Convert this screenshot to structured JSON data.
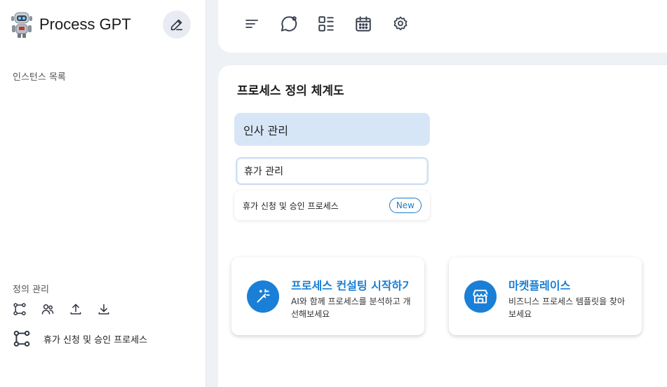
{
  "app": {
    "title": "Process GPT"
  },
  "sidebar": {
    "instances_label": "인스턴스 목록",
    "definitions_label": "정의 관리",
    "definition_icons": [
      "process-flow-icon",
      "users-icon",
      "upload-icon",
      "download-icon"
    ],
    "process_item": "휴가 신청 및 승인 프로세스"
  },
  "toolbar": {
    "icons": [
      "todo-list-icon",
      "chat-bubble-icon",
      "dashboard-list-icon",
      "calendar-icon",
      "gear-icon"
    ]
  },
  "main": {
    "title": "프로세스 정의 체계도",
    "department": "인사 관리",
    "sub_department": "휴가 관리",
    "process": {
      "label": "휴가 신청 및 승인 프로세스",
      "badge": "New"
    }
  },
  "cards": [
    {
      "title": "프로세스 컨설팅 시작하기",
      "description": "AI와 함께 프로세스를 분석하고 개선해보세요",
      "icon": "magic-wand-icon"
    },
    {
      "title": "마켓플레이스",
      "description": "비즈니스 프로세스 템플릿을 찾아보세요",
      "icon": "store-icon"
    }
  ],
  "colors": {
    "accent": "#1a7fd6",
    "department_bg": "#d7e6f7",
    "page_bg": "#eef1f5"
  }
}
